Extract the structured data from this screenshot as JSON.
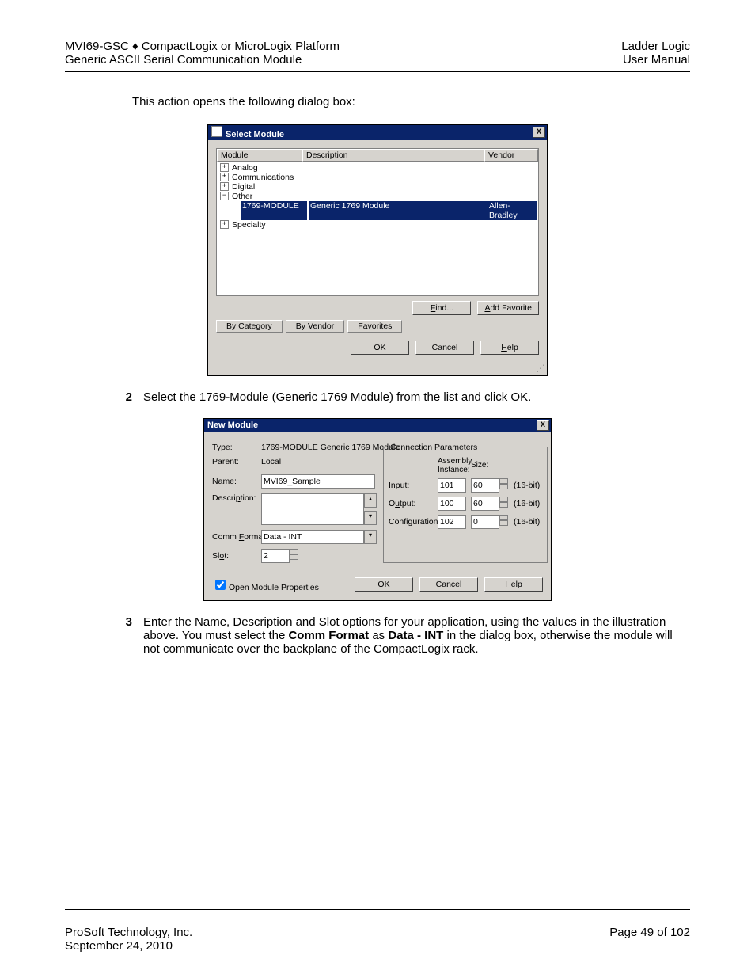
{
  "header": {
    "left_line1": "MVI69-GSC ♦ CompactLogix or MicroLogix Platform",
    "left_line2": "Generic ASCII Serial Communication Module",
    "right_line1": "Ladder Logic",
    "right_line2": "User Manual"
  },
  "body": {
    "intro": "This action opens the following dialog box:",
    "step2_num": "2",
    "step2": "Select the 1769-Module (Generic 1769 Module) from the list and click OK.",
    "step3_num": "3",
    "step3_part1": "Enter the Name, Description and Slot options for your application, using the values in the illustration above. You must select the ",
    "step3_bold1": "Comm Format",
    "step3_mid": " as ",
    "step3_bold2": "Data - INT",
    "step3_part2": " in the dialog box, otherwise the module will not communicate over the backplane of the CompactLogix rack."
  },
  "select_dialog": {
    "title": "Select Module",
    "close": "X",
    "col_module": "Module",
    "col_description": "Description",
    "col_vendor": "Vendor",
    "tree": {
      "analog": "Analog",
      "comm": "Communications",
      "digital": "Digital",
      "other": "Other",
      "sel_name": "1769-MODULE",
      "sel_desc": "Generic 1769 Module",
      "sel_vendor": "Allen-Bradley",
      "specialty": "Specialty"
    },
    "btn_find": "Find...",
    "btn_addfav": "Add Favorite",
    "tab_cat": "By Category",
    "tab_vendor": "By Vendor",
    "tab_fav": "Favorites",
    "btn_ok": "OK",
    "btn_cancel": "Cancel",
    "btn_help": "Help"
  },
  "new_dialog": {
    "title": "New Module",
    "close": "X",
    "type_lbl": "Type:",
    "type_val": "1769-MODULE Generic 1769 Module",
    "parent_lbl": "Parent:",
    "parent_val": "Local",
    "name_lbl": "Name:",
    "name_val": "MVI69_Sample",
    "desc_lbl": "Description:",
    "comm_lbl": "Comm Format:",
    "comm_val": "Data - INT",
    "slot_lbl": "Slot:",
    "slot_val": "2",
    "conn_title": "Connection Parameters",
    "assembly_hdr": "Assembly\nInstance:",
    "size_hdr": "Size:",
    "input_lbl": "Input:",
    "input_inst": "101",
    "input_size": "60",
    "output_lbl": "Output:",
    "output_inst": "100",
    "output_size": "60",
    "config_lbl": "Configuration:",
    "config_inst": "102",
    "config_size": "0",
    "unit": "(16-bit)",
    "open_props": "Open Module Properties",
    "btn_ok": "OK",
    "btn_cancel": "Cancel",
    "btn_help": "Help"
  },
  "footer": {
    "left_line1": "ProSoft Technology, Inc.",
    "left_line2": "September 24, 2010",
    "right": "Page 49 of 102"
  }
}
